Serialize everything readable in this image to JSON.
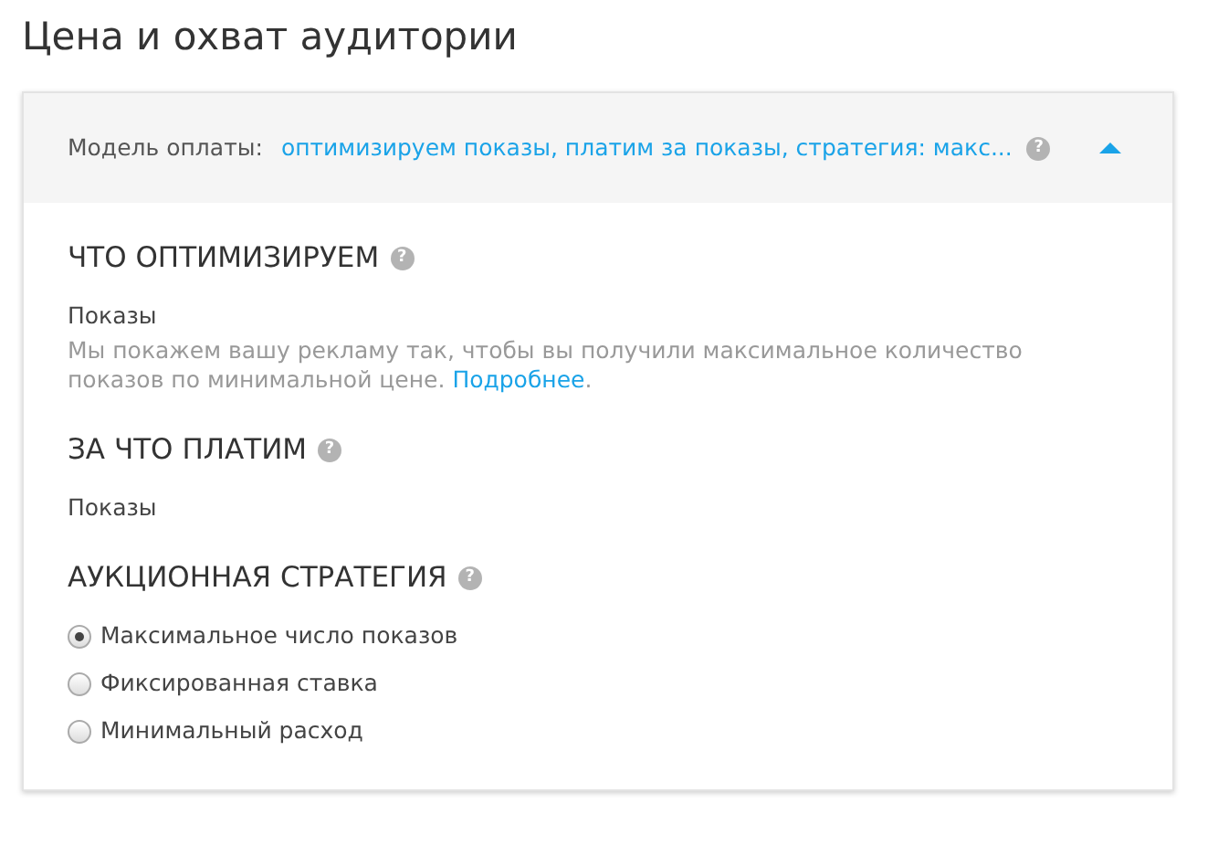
{
  "title": "Цена и охват аудитории",
  "payment_model": {
    "label": "Модель оплаты:",
    "value": "оптимизируем показы, платим за показы, стратегия: макс...",
    "help": "?",
    "expanded": true
  },
  "sections": [
    {
      "heading": "ЧТО ОПТИМИЗИРУЕМ",
      "help": "?",
      "value": "Показы",
      "description": {
        "text": "Мы покажем вашу рекламу так, чтобы вы получили максимальное количество показов по минимальной цене. ",
        "link": "Подробнее",
        "after": "."
      }
    },
    {
      "heading": "ЗА ЧТО ПЛАТИМ",
      "help": "?",
      "value": "Показы"
    },
    {
      "heading": "АУКЦИОННАЯ СТРАТЕГИЯ",
      "help": "?",
      "options": [
        {
          "label": "Максимальное число показов",
          "selected": true
        },
        {
          "label": "Фиксированная ставка",
          "selected": false
        },
        {
          "label": "Минимальный расход",
          "selected": false
        }
      ]
    }
  ]
}
